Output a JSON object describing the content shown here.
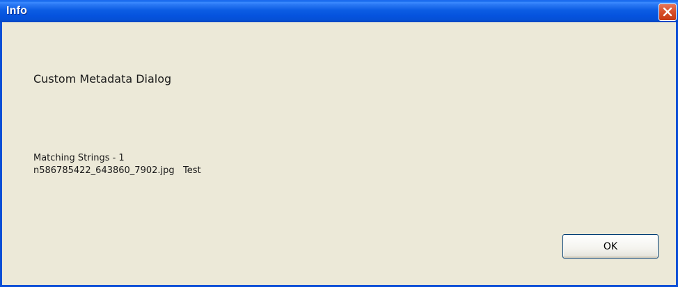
{
  "window": {
    "title": "Info",
    "close_icon": "close-x-icon"
  },
  "dialog": {
    "heading": "Custom Metadata Dialog",
    "message_line1": "Matching Strings - 1",
    "message_line2": "n586785422_643860_7902.jpg   Test",
    "ok_label": "OK"
  },
  "colors": {
    "titlebar": "#0553de",
    "body": "#ece9d8",
    "close_button": "#d9512c",
    "button_border": "#003c74"
  }
}
